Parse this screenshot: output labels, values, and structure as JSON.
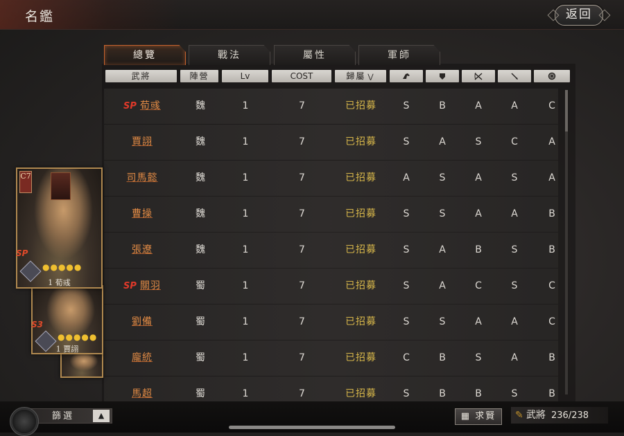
{
  "header": {
    "title": "名鑑",
    "back_label": "返回"
  },
  "tabs": [
    {
      "label": "總覽",
      "active": true
    },
    {
      "label": "戰法",
      "active": false
    },
    {
      "label": "屬性",
      "active": false
    },
    {
      "label": "軍師",
      "active": false
    }
  ],
  "columns": {
    "general": "武將",
    "faction": "陣營",
    "level": "Lv",
    "cost": "COST",
    "status": "歸屬",
    "cavalry_icon": "cavalry-icon",
    "shield_icon": "shield-icon",
    "bow_icon": "crossed-bow-icon",
    "spear_icon": "spear-icon",
    "siege_icon": "siege-wheel-icon"
  },
  "rows": [
    {
      "sp": true,
      "name": "荀彧",
      "faction": "魏",
      "lv": "1",
      "cost": "7",
      "status": "已招募",
      "r1": "S",
      "r2": "B",
      "r3": "A",
      "r4": "A",
      "r5": "C"
    },
    {
      "sp": false,
      "name": "賈詡",
      "faction": "魏",
      "lv": "1",
      "cost": "7",
      "status": "已招募",
      "r1": "S",
      "r2": "A",
      "r3": "S",
      "r4": "C",
      "r5": "A"
    },
    {
      "sp": false,
      "name": "司馬懿",
      "faction": "魏",
      "lv": "1",
      "cost": "7",
      "status": "已招募",
      "r1": "A",
      "r2": "S",
      "r3": "A",
      "r4": "S",
      "r5": "A"
    },
    {
      "sp": false,
      "name": "曹操",
      "faction": "魏",
      "lv": "1",
      "cost": "7",
      "status": "已招募",
      "r1": "S",
      "r2": "S",
      "r3": "A",
      "r4": "A",
      "r5": "B"
    },
    {
      "sp": false,
      "name": "張遼",
      "faction": "魏",
      "lv": "1",
      "cost": "7",
      "status": "已招募",
      "r1": "S",
      "r2": "A",
      "r3": "B",
      "r4": "S",
      "r5": "B"
    },
    {
      "sp": true,
      "name": "關羽",
      "faction": "蜀",
      "lv": "1",
      "cost": "7",
      "status": "已招募",
      "r1": "S",
      "r2": "A",
      "r3": "C",
      "r4": "S",
      "r5": "C"
    },
    {
      "sp": false,
      "name": "劉備",
      "faction": "蜀",
      "lv": "1",
      "cost": "7",
      "status": "已招募",
      "r1": "S",
      "r2": "S",
      "r3": "A",
      "r4": "A",
      "r5": "C"
    },
    {
      "sp": false,
      "name": "龐統",
      "faction": "蜀",
      "lv": "1",
      "cost": "7",
      "status": "已招募",
      "r1": "C",
      "r2": "B",
      "r3": "S",
      "r4": "A",
      "r5": "B"
    },
    {
      "sp": false,
      "name": "馬超",
      "faction": "蜀",
      "lv": "1",
      "cost": "7",
      "status": "已招募",
      "r1": "S",
      "r2": "B",
      "r3": "B",
      "r4": "S",
      "r5": "B"
    }
  ],
  "sp_label": "SP",
  "cards": [
    {
      "tag": "C7",
      "sp": "SP",
      "stars": "●●●●●",
      "name": "1 荀彧"
    },
    {
      "sp": "S3",
      "stars": "●●●●●",
      "name": "1 賈詡"
    }
  ],
  "bottom": {
    "filter_label": "篩選",
    "recruit_label": "求賢",
    "generals_label": "武將",
    "generals_count": "236/238"
  }
}
